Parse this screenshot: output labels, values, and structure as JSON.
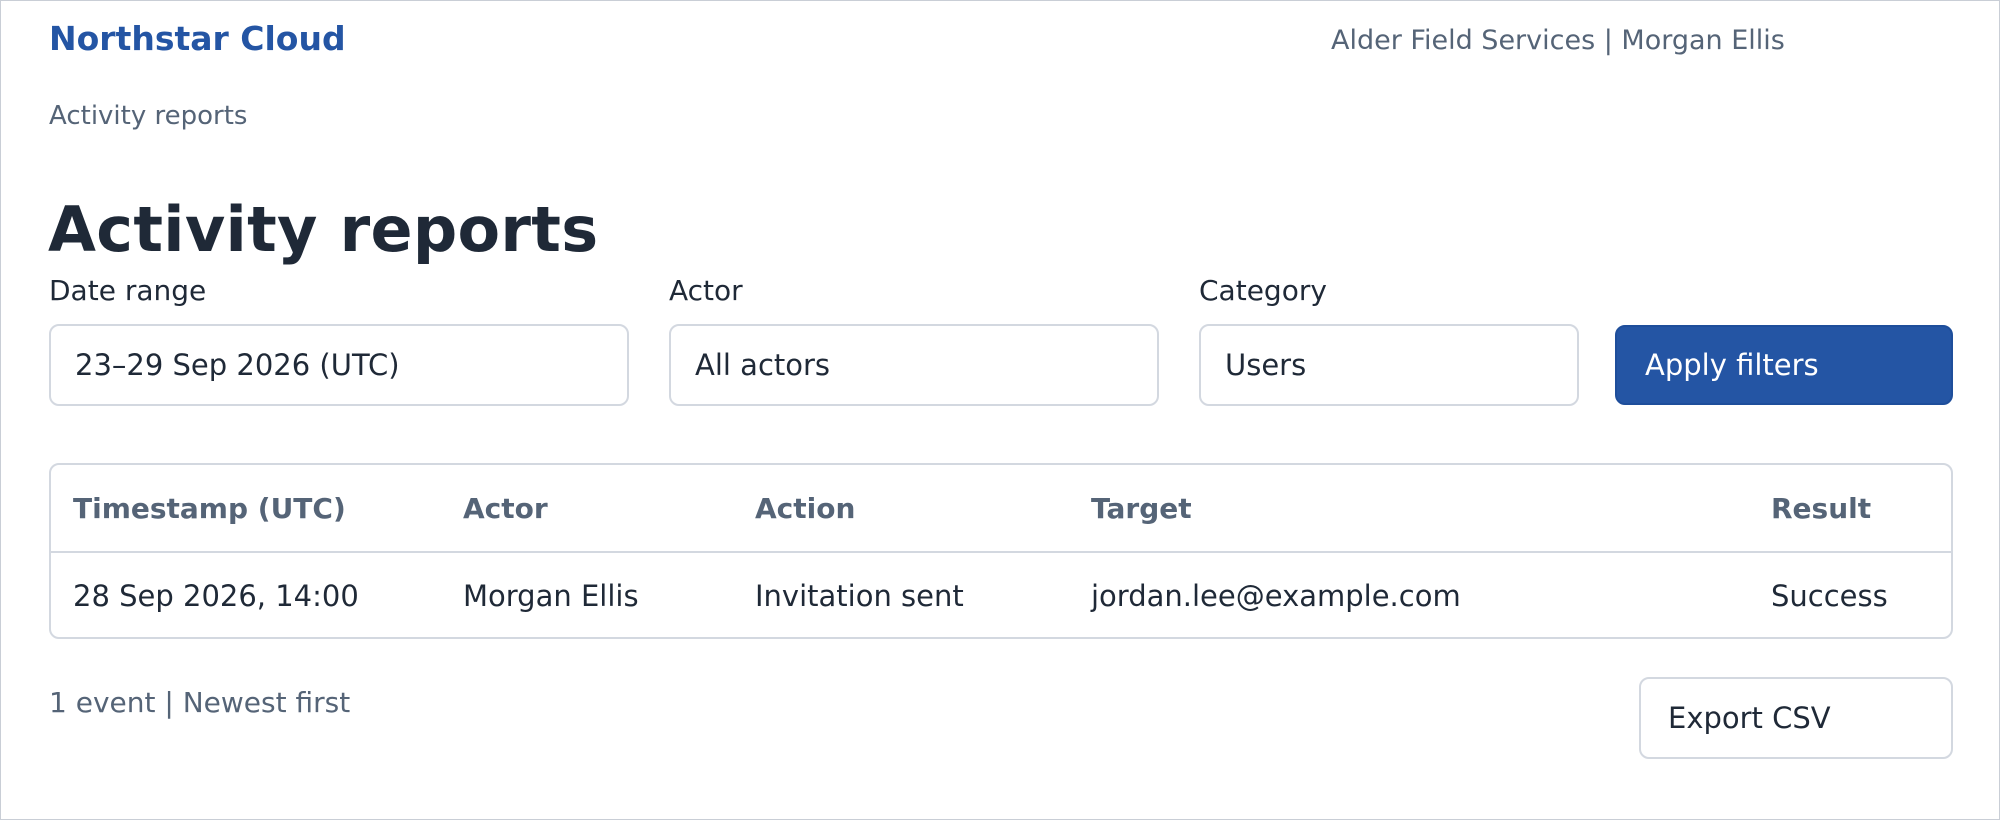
{
  "header": {
    "brand": "Northstar Cloud",
    "account": "Alder Field Services | Morgan Ellis"
  },
  "breadcrumb": "Activity reports",
  "page_title": "Activity reports",
  "filters": {
    "date_range": {
      "label": "Date range",
      "value": "23–29 Sep 2026 (UTC)"
    },
    "actor": {
      "label": "Actor",
      "value": "All actors"
    },
    "category": {
      "label": "Category",
      "value": "Users"
    },
    "apply_label": "Apply filters"
  },
  "table": {
    "columns": [
      "Timestamp (UTC)",
      "Actor",
      "Action",
      "Target",
      "Result"
    ],
    "rows": [
      [
        "28 Sep 2026, 14:00",
        "Morgan Ellis",
        "Invitation sent",
        "jordan.lee@example.com",
        "Success"
      ]
    ]
  },
  "footer": {
    "summary": "1 event | Newest first",
    "export_label": "Export CSV"
  },
  "colors": {
    "brand": "#2455a4",
    "primary_button": "#2455a4",
    "muted_text": "#556477",
    "border": "#d3d8e0"
  }
}
